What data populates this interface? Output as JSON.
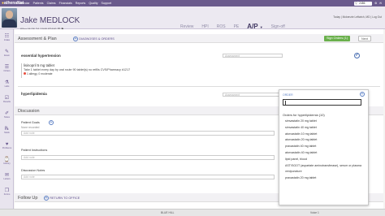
{
  "app": {
    "logo": "athenaNet",
    "nav": [
      "Calendar",
      "Patients",
      "Claims",
      "Financials",
      "Reports",
      "Quality",
      "Support"
    ],
    "search_value": "2486",
    "user_links": [
      "Today",
      "Log Out"
    ],
    "user_text": "Mckenzie Leftwich, MD"
  },
  "patient": {
    "name": "Jake MEDLOCK",
    "meta": "60yo M  06-24-1946  82446  ☰  ⚑",
    "stages": [
      "Review",
      "HPI",
      "ROS",
      "PE",
      "A/P",
      "Sign-off"
    ],
    "active_stage": "A/P"
  },
  "sidebar": [
    {
      "icon": "clipboard-icon",
      "glyph": "☷",
      "label": "Intake"
    },
    {
      "icon": "exam-icon",
      "glyph": "✎",
      "label": "Exam"
    },
    {
      "icon": "orders-icon",
      "glyph": "☰",
      "label": "Orders"
    },
    {
      "icon": "lab-icon",
      "glyph": "⚗",
      "label": "Labs"
    },
    {
      "icon": "results-icon",
      "glyph": "☑",
      "label": "Results"
    },
    {
      "icon": "notes-icon",
      "glyph": "✐",
      "label": "Notes"
    },
    {
      "icon": "rx-icon",
      "glyph": "℞",
      "label": "Meds"
    },
    {
      "icon": "problem-icon",
      "glyph": "♥",
      "label": "Problems"
    },
    {
      "icon": "history-icon",
      "glyph": "⌚",
      "label": "History"
    },
    {
      "icon": "letters-icon",
      "glyph": "✉",
      "label": "Letters"
    },
    {
      "icon": "forms-icon",
      "glyph": "❐",
      "label": "Forms"
    }
  ],
  "assessment": {
    "title": "Assessment & Plan",
    "link": "DIAGNOSES & ORDERS",
    "sign_orders": "Sign Orders (1)",
    "next": "Next",
    "dx1": "essential hypertension",
    "dx1_placeholder": "Assessment",
    "med_name": "lisinopril 5 mg tablet",
    "med_sig": "Take 1 tablet every day by oral route    90 tablet(s)   no refills    CVS/Pharmacy #1217",
    "med_allergy": "1 allergy, 0 moderate",
    "dx2": "hyperlipidemia",
    "dx2_placeholder": "Assessment"
  },
  "discussion": {
    "title": "Discussion",
    "goals_label": "Patient Goals",
    "goals_sub": "None recorded",
    "goals_placeholder": "Add note",
    "instructions_label": "Patient Instructions",
    "instructions_placeholder": "Add note",
    "notes_label": "Discussion Notes",
    "notes_placeholder": "Add note"
  },
  "followup": {
    "title": "Follow Up",
    "link": "RETURN TO OFFICE"
  },
  "order_panel": {
    "header": "ORDER",
    "group": "Orders for hyperlipidemia (10)",
    "items": [
      "simvastatin 20 mg tablet",
      "simvastatin 40 mg tablet",
      "atorvastatin 10 mg tablet",
      "atorvastatin 20 mg tablet",
      "pravastatin 40 mg tablet",
      "atorvastatin 40 mg tablet",
      "lipid panel, blood",
      "AST/SGOT (aspartate aminotransferase), serum or plasma",
      "venipuncture",
      "pravastatin 20 mg tablet"
    ]
  },
  "status": {
    "left": "BLUE HILL",
    "right": "Voice 1"
  }
}
